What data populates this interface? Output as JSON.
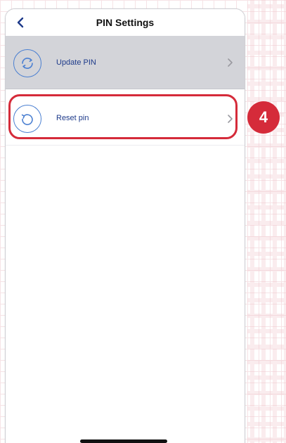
{
  "header": {
    "title": "PIN Settings",
    "back_icon": "chevron-left-icon"
  },
  "menu": {
    "items": [
      {
        "label": "Update PIN",
        "icon": "refresh-icon",
        "selected": true
      },
      {
        "label": "Reset pin",
        "icon": "reset-icon",
        "selected": false
      }
    ]
  },
  "annotation": {
    "step_number": "4"
  },
  "colors": {
    "accent_blue": "#4a7fd1",
    "label_navy": "#1d3a8a",
    "highlight_red": "#d52b3a",
    "selected_row_bg": "#d3d4d9"
  }
}
